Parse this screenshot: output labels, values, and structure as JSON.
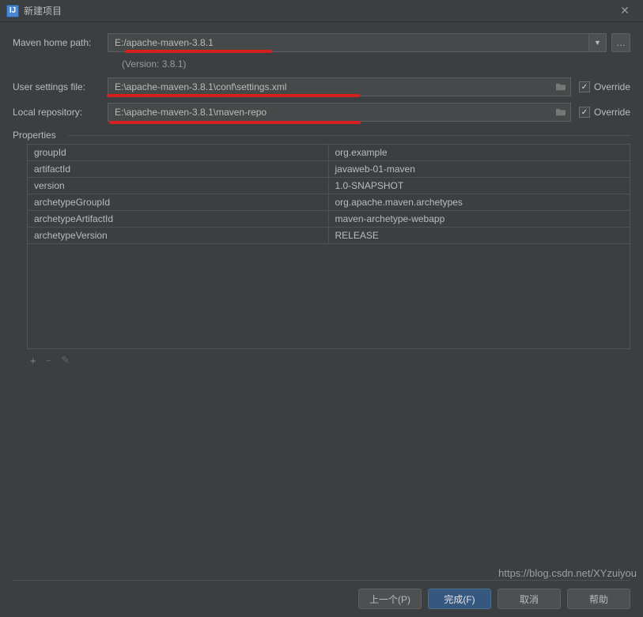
{
  "titlebar": {
    "title": "新建项目"
  },
  "form": {
    "maven_home_label": "Maven home path:",
    "maven_home_value": "E:/apache-maven-3.8.1",
    "version_text": "(Version: 3.8.1)",
    "user_settings_label": "User settings file:",
    "user_settings_value": "E:\\apache-maven-3.8.1\\conf\\settings.xml",
    "local_repo_label": "Local repository:",
    "local_repo_value": "E:\\apache-maven-3.8.1\\maven-repo",
    "override_label": "Override",
    "override1_checked": true,
    "override2_checked": true
  },
  "properties_section": {
    "title": "Properties",
    "rows": [
      {
        "key": "groupId",
        "value": "org.example"
      },
      {
        "key": "artifactId",
        "value": "javaweb-01-maven"
      },
      {
        "key": "version",
        "value": "1.0-SNAPSHOT"
      },
      {
        "key": "archetypeGroupId",
        "value": "org.apache.maven.archetypes"
      },
      {
        "key": "archetypeArtifactId",
        "value": "maven-archetype-webapp"
      },
      {
        "key": "archetypeVersion",
        "value": "RELEASE"
      }
    ],
    "toolbar": {
      "add": "+",
      "remove": "−",
      "edit": "✎"
    }
  },
  "footer": {
    "prev": "上一个(P)",
    "finish": "完成(F)",
    "cancel": "取消",
    "help": "帮助"
  },
  "watermark": "https://blog.csdn.net/XYzuiyou"
}
